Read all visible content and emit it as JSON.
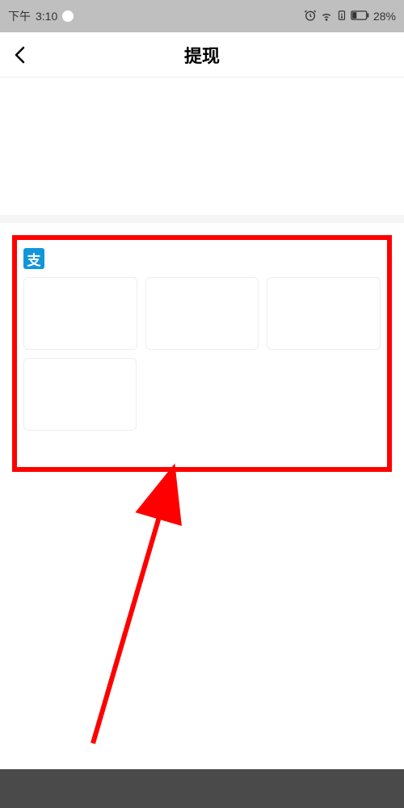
{
  "status": {
    "time_prefix": "下午",
    "time": "3:10",
    "battery": "28%"
  },
  "nav": {
    "title": "提现"
  },
  "payment": {
    "alipay_glyph": "支"
  },
  "annotation": {
    "box_color": "#ff0000",
    "arrow_color": "#ff0000"
  }
}
